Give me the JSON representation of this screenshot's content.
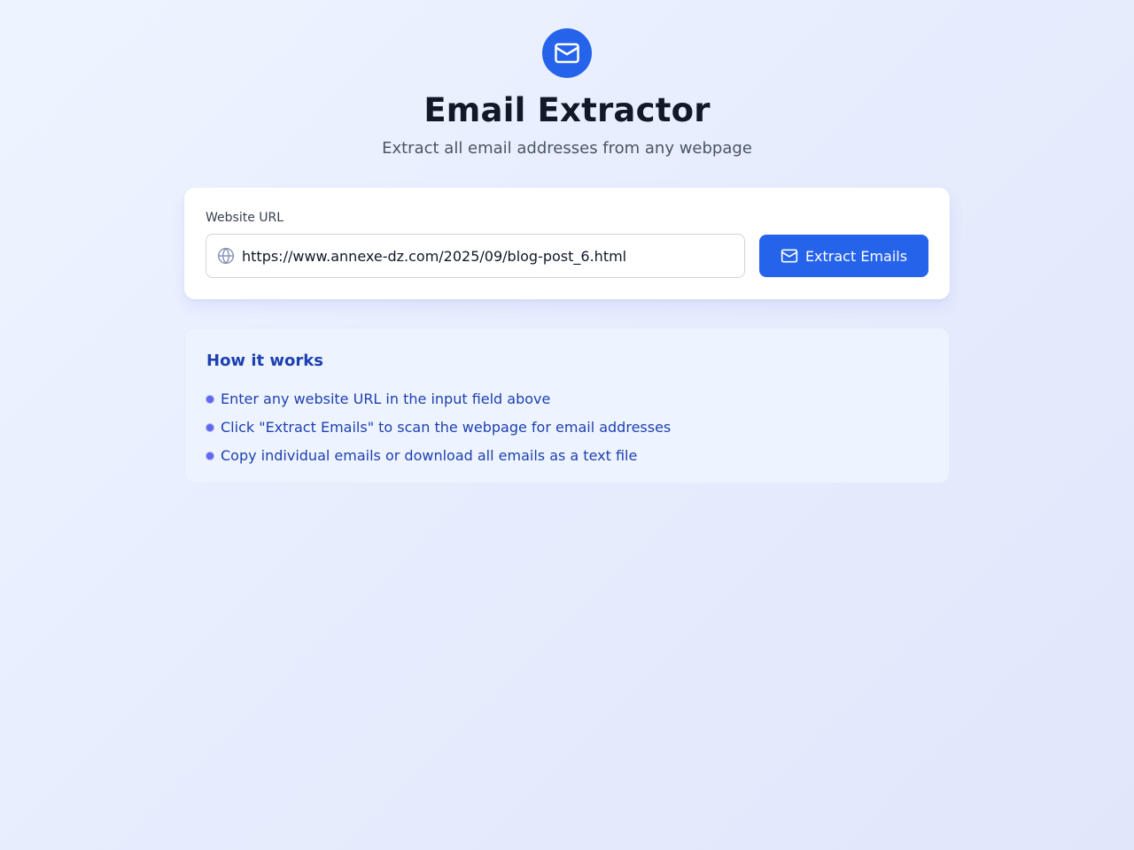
{
  "header": {
    "logo_icon": "mail-icon",
    "title": "Email Extractor",
    "subtitle": "Extract all email addresses from any webpage"
  },
  "form": {
    "url_label": "Website URL",
    "url_icon": "globe-icon",
    "url_value": "https://www.annexe-dz.com/2025/09/blog-post_6.html",
    "button_icon": "mail-icon",
    "button_label": "Extract Emails"
  },
  "how_it_works": {
    "title": "How it works",
    "items": [
      "Enter any website URL in the input field above",
      "Click \"Extract Emails\" to scan the webpage for email addresses",
      "Copy individual emails or download all emails as a text file"
    ]
  },
  "colors": {
    "accent": "#2563eb",
    "info_text": "#1e40af",
    "bullet": "#6366f1"
  }
}
